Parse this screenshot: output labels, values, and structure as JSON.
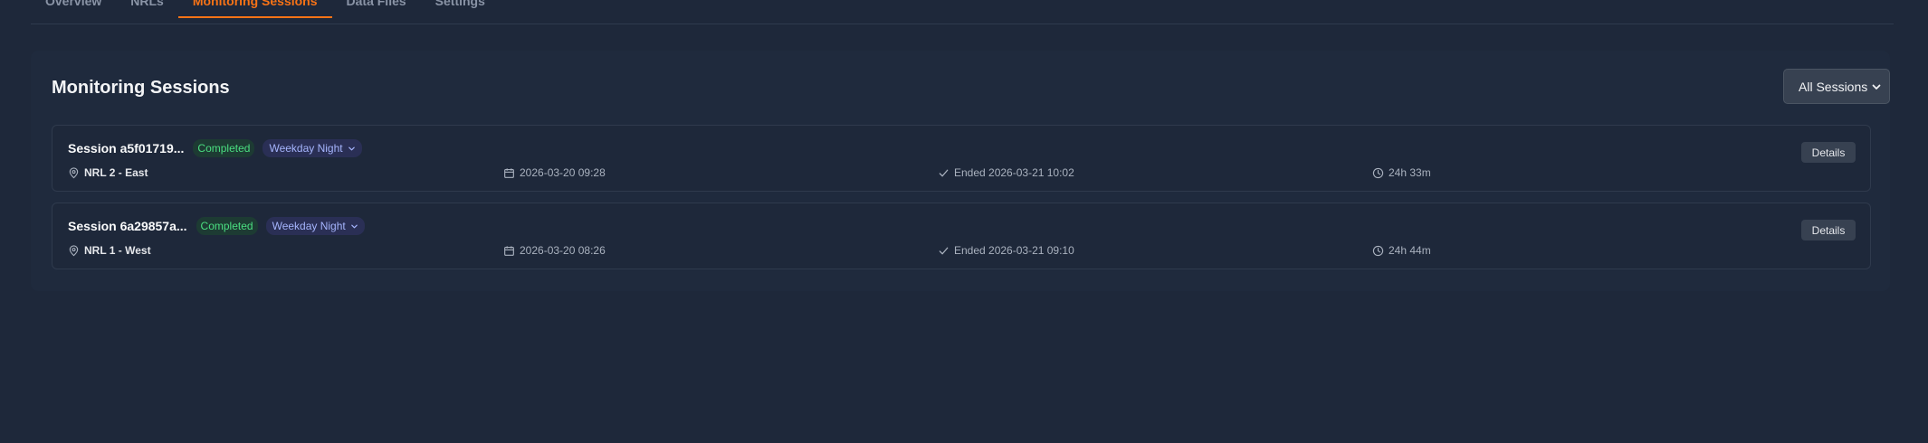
{
  "tabs": [
    {
      "label": "Overview",
      "active": false
    },
    {
      "label": "NRLs",
      "active": false
    },
    {
      "label": "Monitoring Sessions",
      "active": true
    },
    {
      "label": "Data Files",
      "active": false
    },
    {
      "label": "Settings",
      "active": false
    }
  ],
  "panel": {
    "title": "Monitoring Sessions",
    "filter": {
      "selected": "All Sessions"
    }
  },
  "sessions": [
    {
      "name": "Session a5f01719...",
      "status": "Completed",
      "profile": "Weekday Night",
      "location": "NRL 2 - East",
      "start": "2026-03-20 09:28",
      "ended": "Ended 2026-03-21 10:02",
      "duration": "24h 33m",
      "details_label": "Details"
    },
    {
      "name": "Session 6a29857a...",
      "status": "Completed",
      "profile": "Weekday Night",
      "location": "NRL 1 - West",
      "start": "2026-03-20 08:26",
      "ended": "Ended 2026-03-21 09:10",
      "duration": "24h 44m",
      "details_label": "Details"
    }
  ],
  "colors": {
    "accent": "#f97316",
    "completed": "#4ade80",
    "profile": "#a5b4fc",
    "background": "#1e283a"
  }
}
